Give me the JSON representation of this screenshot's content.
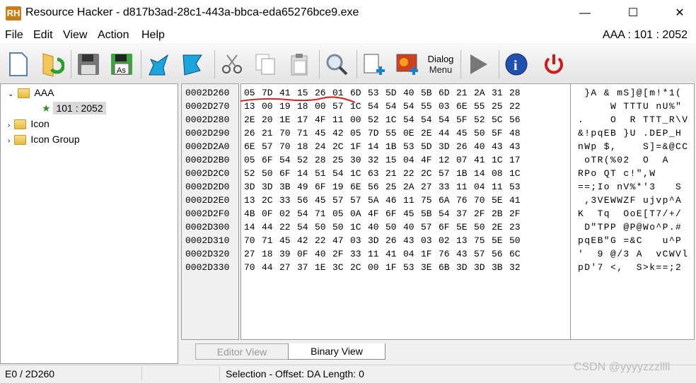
{
  "window": {
    "app_logo": "RH",
    "title": "Resource Hacker - d817b3ad-28c1-443a-bbca-eda65276bce9.exe",
    "minimize": "—",
    "maximize": "☐",
    "close": "✕"
  },
  "menu": [
    "File",
    "Edit",
    "View",
    "Action",
    "Help"
  ],
  "resource_id": "AAA : 101 : 2052",
  "toolbar": {
    "icons": [
      "new-file-icon",
      "open-file-icon",
      "save-icon",
      "save-as-icon",
      "back-arrow-icon",
      "forward-arrow-icon",
      "cut-icon",
      "copy-icon",
      "paste-icon",
      "search-icon",
      "add-blank-resource-icon",
      "add-image-resource-icon",
      "add-dialog-menu-icon",
      "run-script-icon",
      "about-icon",
      "exit-icon"
    ],
    "save_as_label": "As",
    "dialog_label": "Dialog",
    "menu_label": "Menu"
  },
  "tree": [
    {
      "label": "AAA",
      "expanded": true
    },
    {
      "label": "101 : 2052",
      "selected": true
    },
    {
      "label": "Icon"
    },
    {
      "label": "Icon Group"
    }
  ],
  "hex": {
    "offsets": [
      "0002D260",
      "0002D270",
      "0002D280",
      "0002D290",
      "0002D2A0",
      "0002D2B0",
      "0002D2C0",
      "0002D2D0",
      "0002D2E0",
      "0002D2F0",
      "0002D300",
      "0002D310",
      "0002D320",
      "0002D330"
    ],
    "rows": [
      "05 7D 41 15 26 01 6D 53 5D 40 5B 6D 21 2A 31 28",
      "13 00 19 18 00 57 1C 54 54 54 55 03 6E 55 25 22",
      "2E 20 1E 17 4F 11 00 52 1C 54 54 54 5F 52 5C 56",
      "26 21 70 71 45 42 05 7D 55 0E 2E 44 45 50 5F 48",
      "6E 57 70 18 24 2C 1F 14 1B 53 5D 3D 26 40 43 43",
      "05 6F 54 52 28 25 30 32 15 04 4F 12 07 41 1C 17",
      "52 50 6F 14 51 54 1C 63 21 22 2C 57 1B 14 08 1C",
      "3D 3D 3B 49 6F 19 6E 56 25 2A 27 33 11 04 11 53",
      "13 2C 33 56 45 57 57 5A 46 11 75 6A 76 70 5E 41",
      "4B 0F 02 54 71 05 0A 4F 6F 45 5B 54 37 2F 2B 2F",
      "14 44 22 54 50 50 1C 40 50 40 57 6F 5E 50 2E 23",
      "70 71 45 42 22 47 03 3D 26 43 03 02 13 75 5E 50",
      "27 18 39 0F 40 2F 33 11 41 04 1F 76 43 57 56 6C",
      "70 44 27 37 1E 3C 2C 00 1F 53 3E 6B 3D 3D 3B 32"
    ],
    "ascii": [
      " }A & mS]@[m!*1(",
      "     W TTTU nU%\"",
      ".    O  R TTT_R\\V",
      "&!pqEB }U .DEP_H",
      "nWp $,    S]=&@CC",
      " oTR(%02  O  A",
      "RPo QT c!\",W",
      "==;Io nV%*'3   S",
      " ,3VEWWZF ujvp^A",
      "K  Tq  OoE[T7/+/",
      " D\"TPP @P@Wo^P.#",
      "pqEB\"G =&C   u^P",
      "'  9 @/3 A  vCWVl",
      "pD'7 <,  S>k==;2"
    ],
    "annotation_color": "#e02020"
  },
  "tabs": [
    {
      "label": "Editor View",
      "active": false
    },
    {
      "label": "Binary View",
      "active": true
    }
  ],
  "status": {
    "position": "E0 / 2D260",
    "selection": "Selection - Offset: DA Length: 0"
  },
  "watermark": "CSDN @yyyyzzzllll"
}
